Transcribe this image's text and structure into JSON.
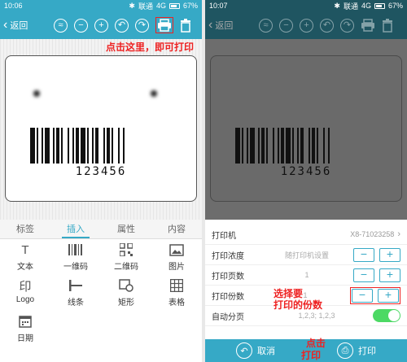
{
  "left": {
    "status": {
      "time": "10:06",
      "carrier": "联通",
      "network": "4G",
      "battery": "67%"
    },
    "toolbar": {
      "back_label": "返回"
    },
    "annotation": "点击这里，即可打印",
    "barcode_number": "123456",
    "tabs": [
      "标签",
      "插入",
      "属性",
      "内容"
    ],
    "tools": [
      {
        "icon": "text-icon",
        "glyph": "T",
        "label": "文本"
      },
      {
        "icon": "barcode-icon",
        "glyph": "▮▮▮",
        "label": "一维码"
      },
      {
        "icon": "qrcode-icon",
        "glyph": "▦",
        "label": "二维码"
      },
      {
        "icon": "image-icon",
        "glyph": "▣",
        "label": "图片"
      },
      {
        "icon": "logo-icon",
        "glyph": "印",
        "label": "Logo"
      },
      {
        "icon": "line-icon",
        "glyph": "┣",
        "label": "线条"
      },
      {
        "icon": "rectangle-icon",
        "glyph": "◫",
        "label": "矩形"
      },
      {
        "icon": "table-icon",
        "glyph": "▦",
        "label": "表格"
      },
      {
        "icon": "date-icon",
        "glyph": "▤",
        "label": "日期"
      }
    ]
  },
  "right": {
    "status": {
      "time": "10:07",
      "carrier": "联通",
      "network": "4G",
      "battery": "67%"
    },
    "toolbar": {
      "back_label": "返回"
    },
    "barcode_number": "123456",
    "rows": {
      "printer": {
        "label": "打印机",
        "value": "X8-71023258"
      },
      "density": {
        "label": "打印浓度",
        "value": "随打印机设置"
      },
      "pages": {
        "label": "打印页数",
        "value": "1"
      },
      "copies": {
        "label": "打印份数",
        "value": "1"
      },
      "auto_paging": {
        "label": "自动分页",
        "value": "1,2,3; 1,2,3"
      }
    },
    "annotation_copies_1": "选择要",
    "annotation_copies_2": "打印的份数",
    "annotation_print_1": "点击",
    "annotation_print_2": "打印",
    "cancel_label": "取消",
    "print_label": "打印"
  },
  "colors": {
    "accent": "#36a9c6",
    "annotation": "#e22222",
    "toggle_on": "#4cd964"
  }
}
